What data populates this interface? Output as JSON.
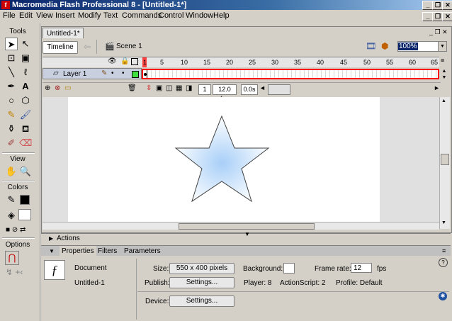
{
  "window": {
    "title": "Macromedia Flash Professional 8 - [Untitled-1*]",
    "app_icon": "flash-app-icon"
  },
  "menu": [
    "File",
    "Edit",
    "View",
    "Insert",
    "Modify",
    "Text",
    "Commands",
    "Control",
    "Window",
    "Help"
  ],
  "tools": {
    "header": "Tools",
    "view_header": "View",
    "colors_header": "Colors",
    "options_header": "Options"
  },
  "document": {
    "tab": "Untitled-1*",
    "timeline_button": "Timeline",
    "scene": "Scene 1",
    "zoom": "100%"
  },
  "timeline": {
    "layer_name": "Layer 1",
    "ruler": [
      "1",
      "5",
      "10",
      "15",
      "20",
      "25",
      "30",
      "35",
      "40",
      "45",
      "50",
      "55",
      "60",
      "65"
    ],
    "current_frame": "1",
    "fps": "12.0 fps",
    "time": "0.0s"
  },
  "panels": {
    "actions": "Actions",
    "tabs": [
      "Properties",
      "Filters",
      "Parameters"
    ]
  },
  "properties": {
    "doc_type": "Document",
    "doc_name": "Untitled-1",
    "size_label": "Size:",
    "size_value": "550 x 400 pixels",
    "background_label": "Background:",
    "frame_rate_label": "Frame rate:",
    "frame_rate_value": "12",
    "fps_unit": "fps",
    "publish_label": "Publish:",
    "settings_label": "Settings...",
    "player_text": "Player: 8",
    "actionscript_text": "ActionScript: 2",
    "profile_text": "Profile: Default",
    "device_label": "Device:",
    "device_settings_label": "Settings..."
  },
  "colors": {
    "accent": "#ff0000",
    "title_bar": "#0a246a",
    "star_fill": "#cfe4f8"
  }
}
